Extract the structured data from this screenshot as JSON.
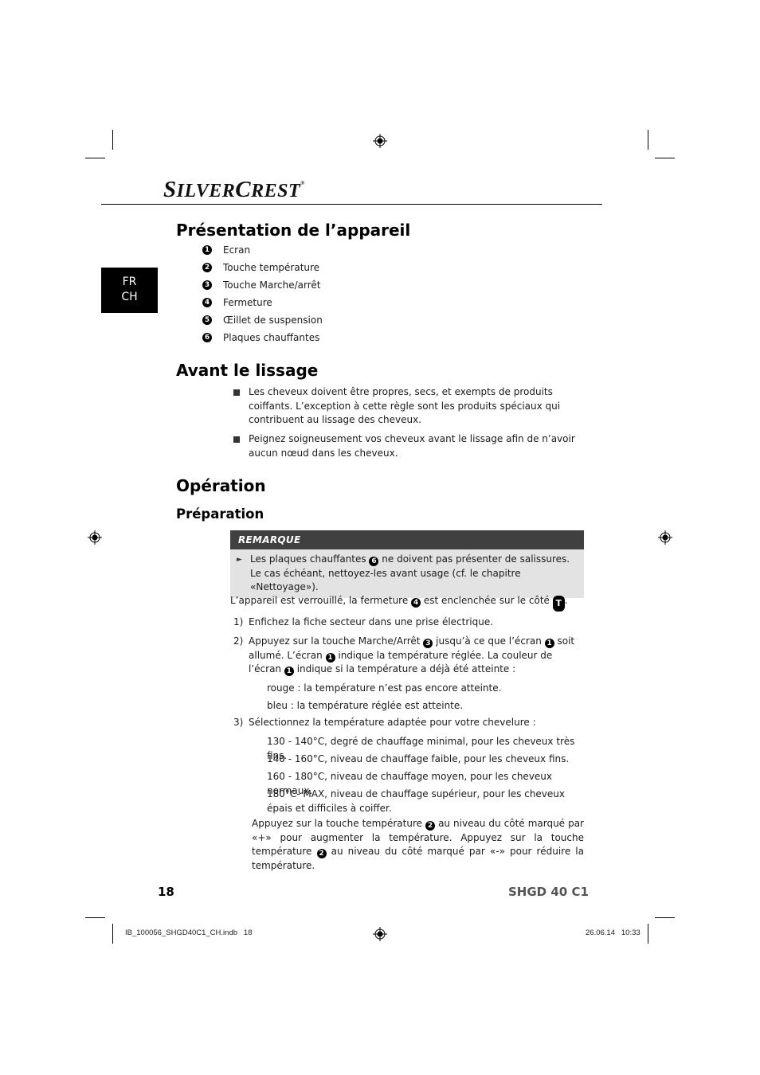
{
  "brand": {
    "logo_first": "S",
    "logo_rest1": "ILVER",
    "logo_c": "C",
    "logo_rest2": "REST",
    "registered": "®"
  },
  "language_tab": {
    "line1": "FR",
    "line2": "CH"
  },
  "sections": {
    "presentation": {
      "title": "Présentation de l’appareil",
      "items": [
        {
          "num": "1",
          "label": "Ecran"
        },
        {
          "num": "2",
          "label": "Touche température"
        },
        {
          "num": "3",
          "label": "Touche Marche/arrêt"
        },
        {
          "num": "4",
          "label": "Fermeture"
        },
        {
          "num": "5",
          "label": "Œillet de suspension"
        },
        {
          "num": "6",
          "label": "Plaques chauffantes"
        }
      ]
    },
    "avant": {
      "title": "Avant le lissage",
      "bullets": [
        "Les cheveux doivent être propres, secs, et exempts de produits coiffants. L’exception à cette règle sont les produits spéciaux qui contribuent au lissage des cheveux.",
        "Peignez soigneusement vos cheveux avant le lissage afin de n’avoir aucun nœud dans les cheveux."
      ]
    },
    "operation": {
      "title": "Opération",
      "subtitle": "Préparation",
      "note": {
        "heading": "REMARQUE",
        "text_before": "Les plaques chauffantes",
        "ref": "6",
        "text_after": "ne doivent pas présenter de salissures. Le cas échéant, nettoyez-les avant usage (cf. le chapitre «Nettoyage»)."
      },
      "intro": {
        "before": "L’appareil est verrouillé, la fermeture",
        "ref": "4",
        "middle": "est enclenchée sur le côté",
        "lock_symbol": "T",
        "after": "."
      },
      "steps": [
        {
          "n": "1)",
          "text": "Enfichez la fiche secteur dans une prise électrique."
        },
        {
          "n": "2)",
          "parts": [
            "Appuyez sur la touche Marche/Arrêt",
            "3",
            "jusqu’à ce que l’écran",
            "1",
            "soit allumé. L’écran",
            "1",
            "indique la température réglée. La couleur de l’écran",
            "1",
            "indique si la température a déjà été atteinte :"
          ]
        },
        {
          "n": "3)",
          "text": "Sélectionnez la température adaptée pour votre chevelure :"
        }
      ],
      "colors": [
        "rouge : la température n’est pas encore atteinte.",
        "bleu : la température réglée est atteinte."
      ],
      "temperatures": [
        "130 - 140°C, degré de chauffage minimal, pour les cheveux très fins.",
        "140 - 160°C, niveau de chauffage faible, pour les cheveux fins.",
        "160 - 180°C, niveau de chauffage moyen, pour les cheveux normaux.",
        "180°C- MAX, niveau de chauffage supérieur, pour les cheveux épais et difficiles à coiffer."
      ],
      "adjust": {
        "p1": "Appuyez sur la touche température",
        "ref1": "2",
        "p2": "au niveau du côté marqué par «+» pour augmenter la température. Appuyez sur la touche température",
        "ref2": "2",
        "p3": "au niveau du côté marqué par «-» pour réduire la température."
      }
    }
  },
  "footer": {
    "page": "18",
    "model": "SHGD 40 C1"
  },
  "slug": {
    "file": "IB_100056_SHGD40C1_CH.indb   18",
    "datetime": "26.06.14   10:33"
  }
}
